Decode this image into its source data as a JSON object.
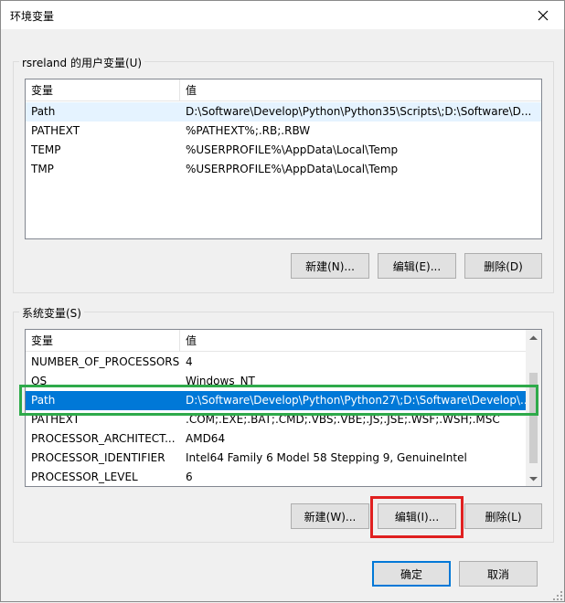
{
  "window": {
    "title": "环境变量"
  },
  "user_vars": {
    "group_label": "rsreland 的用户变量(U)",
    "columns": [
      "变量",
      "值"
    ],
    "rows": [
      {
        "name": "Path",
        "value": "D:\\Software\\Develop\\Python\\Python35\\Scripts\\;D:\\Software\\D..."
      },
      {
        "name": "PATHEXT",
        "value": "%PATHEXT%;.RB;.RBW"
      },
      {
        "name": "TEMP",
        "value": "%USERPROFILE%\\AppData\\Local\\Temp"
      },
      {
        "name": "TMP",
        "value": "%USERPROFILE%\\AppData\\Local\\Temp"
      }
    ],
    "buttons": {
      "new": "新建(N)...",
      "edit": "编辑(E)...",
      "delete": "删除(D)"
    }
  },
  "system_vars": {
    "group_label": "系统变量(S)",
    "columns": [
      "变量",
      "值"
    ],
    "rows": [
      {
        "name": "NUMBER_OF_PROCESSORS",
        "value": "4"
      },
      {
        "name": "OS",
        "value": "Windows_NT"
      },
      {
        "name": "Path",
        "value": "D:\\Software\\Develop\\Python\\Python27\\;D:\\Software\\Develop\\..."
      },
      {
        "name": "PATHEXT",
        "value": ".COM;.EXE;.BAT;.CMD;.VBS;.VBE;.JS;.JSE;.WSF;.WSH;.MSC"
      },
      {
        "name": "PROCESSOR_ARCHITECT...",
        "value": "AMD64"
      },
      {
        "name": "PROCESSOR_IDENTIFIER",
        "value": "Intel64 Family 6 Model 58 Stepping 9, GenuineIntel"
      },
      {
        "name": "PROCESSOR_LEVEL",
        "value": "6"
      }
    ],
    "buttons": {
      "new": "新建(W)...",
      "edit": "编辑(I)...",
      "delete": "删除(L)"
    }
  },
  "footer": {
    "ok": "确定",
    "cancel": "取消"
  },
  "colors": {
    "selection": "#0078d7",
    "annotation_green": "#2eaa4a",
    "annotation_red": "#e02020"
  }
}
